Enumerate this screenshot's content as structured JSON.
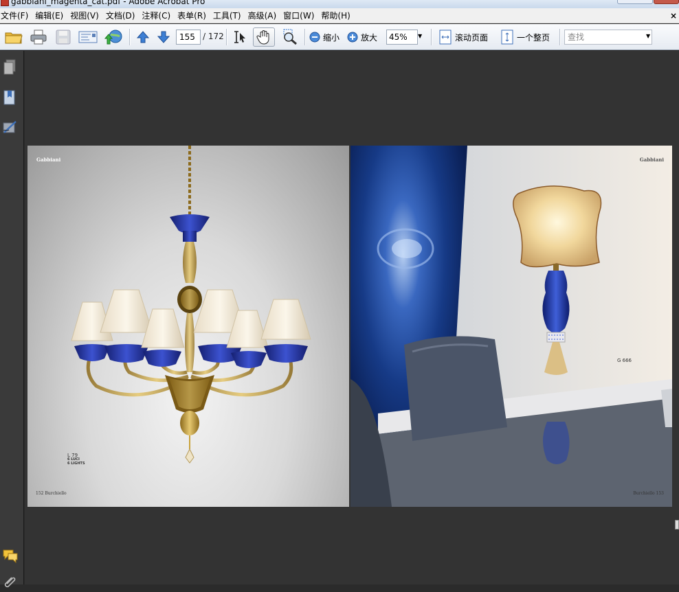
{
  "window": {
    "title": "gabbiani_magenta_cat.pdf - Adobe Acrobat Pro"
  },
  "menu": {
    "items": [
      "文件(F)",
      "编辑(E)",
      "视图(V)",
      "文档(D)",
      "注释(C)",
      "表单(R)",
      "工具(T)",
      "高级(A)",
      "窗口(W)",
      "帮助(H)"
    ],
    "close_glyph": "×"
  },
  "toolbar": {
    "current_page": "155",
    "total_pages": "/ 172",
    "zoom_out_label": "缩小",
    "zoom_in_label": "放大",
    "zoom_value": "45%",
    "scroll_mode_label": "滚动页面",
    "single_page_label": "一个整页",
    "find_placeholder": "查找"
  },
  "document": {
    "left_page": {
      "brand": "Gabbiani",
      "model_code": "L 79",
      "model_luci": "6 LUCI",
      "model_lights": "6 LIGHTS",
      "footer": "152  Burchiello"
    },
    "right_page": {
      "brand": "Gabbiani",
      "model_code": "G 666",
      "footer": "Burchiello  153"
    }
  },
  "colors": {
    "doc_background": "#333333",
    "toolbar_bg": "#e6ebf2",
    "glass_blue": "#2a3fa8",
    "gold": "#c9a23a"
  }
}
